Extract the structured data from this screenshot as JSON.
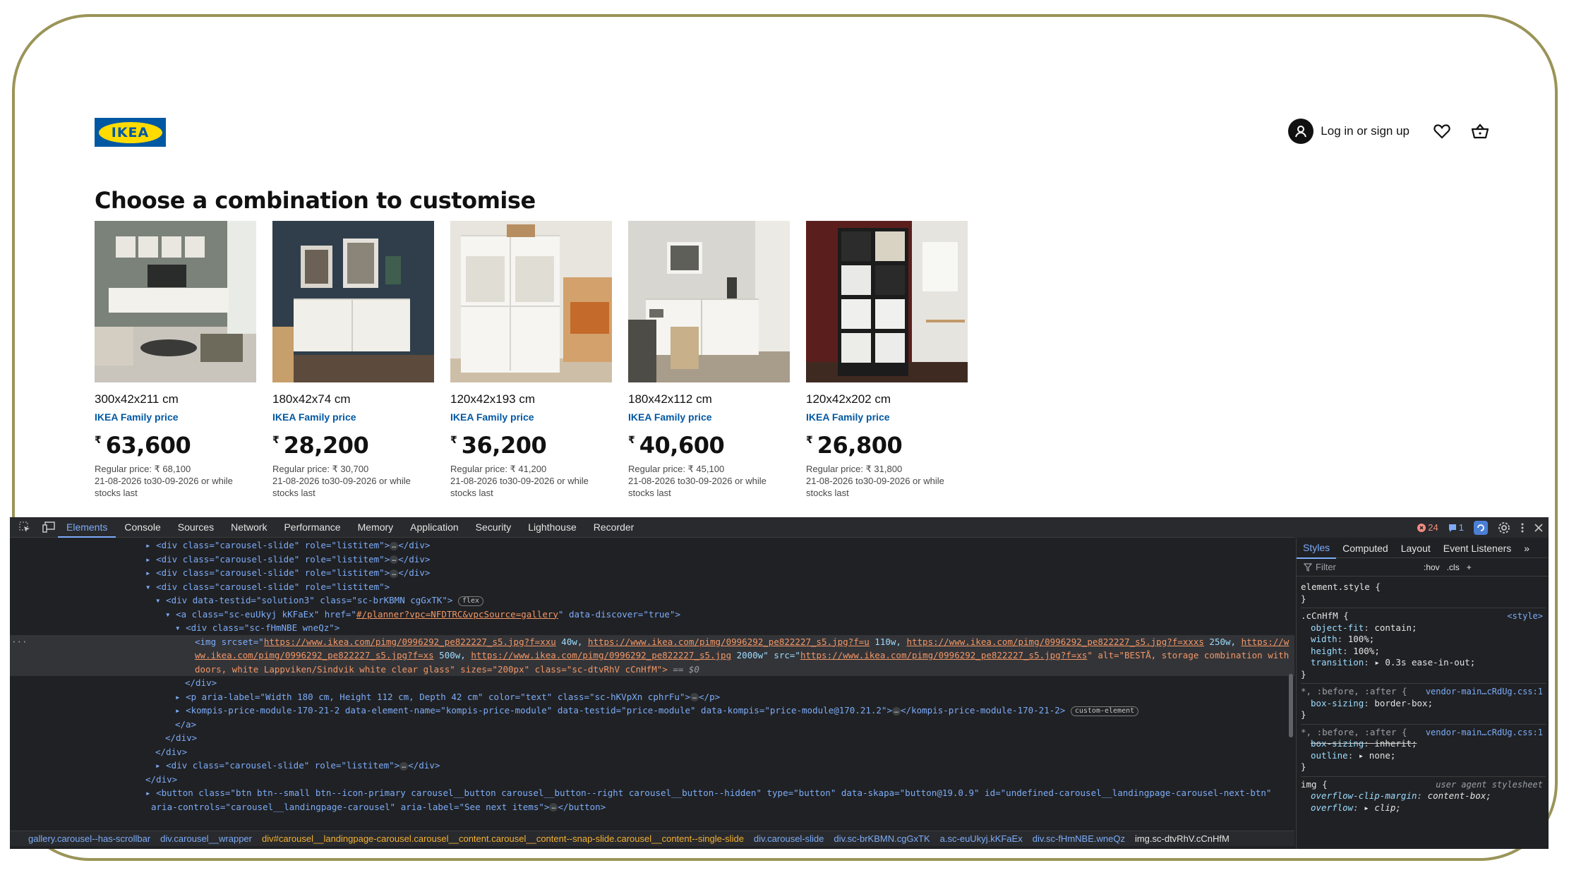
{
  "header": {
    "logo_text": "IKEA",
    "login_label": "Log in or sign up",
    "icons": [
      "user-icon",
      "heart-icon",
      "basket-icon"
    ]
  },
  "page": {
    "title": "Choose a combination to customise"
  },
  "products": [
    {
      "dims": "300x42x211 cm",
      "family": "IKEA Family price",
      "currency": "₹",
      "price": "63,600",
      "regular": "Regular price: ₹ 68,100",
      "validity": "21-08-2026 to30-09-2026 or while stocks last"
    },
    {
      "dims": "180x42x74 cm",
      "family": "IKEA Family price",
      "currency": "₹",
      "price": "28,200",
      "regular": "Regular price: ₹ 30,700",
      "validity": "21-08-2026 to30-09-2026 or while stocks last"
    },
    {
      "dims": "120x42x193 cm",
      "family": "IKEA Family price",
      "currency": "₹",
      "price": "36,200",
      "regular": "Regular price: ₹ 41,200",
      "validity": "21-08-2026 to30-09-2026 or while stocks last"
    },
    {
      "dims": "180x42x112 cm",
      "family": "IKEA Family price",
      "currency": "₹",
      "price": "40,600",
      "regular": "Regular price: ₹ 45,100",
      "validity": "21-08-2026 to30-09-2026 or while stocks last"
    },
    {
      "dims": "120x42x202 cm",
      "family": "IKEA Family price",
      "currency": "₹",
      "price": "26,800",
      "regular": "Regular price: ₹ 31,800",
      "validity": "21-08-2026 to30-09-2026 or while stocks last"
    }
  ],
  "devtools": {
    "tabs": [
      "Elements",
      "Console",
      "Sources",
      "Network",
      "Performance",
      "Memory",
      "Application",
      "Security",
      "Lighthouse",
      "Recorder"
    ],
    "active_tab": "Elements",
    "error_count": "24",
    "message_count": "1",
    "dom": {
      "slide_open": "<div class=\"carousel-slide\" role=\"listitem\">",
      "div_close": "</div>",
      "solution_div": "<div data-testid=\"solution3\" class=\"sc-brKBMN cgGxTK\">",
      "flex_badge": "flex",
      "anchor_open": "<a class=\"sc-euUkyj kKFaEx\" href=\"",
      "anchor_href": "#/planner?vpc=NFDTRC&vpcSource=gallery",
      "anchor_rest": "\" data-discover=\"true\">",
      "img_div": "<div class=\"sc-fHmNBE wneQz\">",
      "img_line1_a": "<img srcset=\"",
      "img_url1": "https://www.ikea.com/pimg/0996292_pe822227_s5.jpg?f=xxu",
      "img_w1": " 40w, ",
      "img_url2": "https://www.ikea.com/pimg/0996292_pe822227_s5.jpg?f=u",
      "img_w2": " 110w, ",
      "img_url3": "https://www.ikea.com/pimg/0996292_pe822227_s5.jpg?f=xxxs",
      "img_w3": " 250w, ",
      "img_url4a": "https://w",
      "img_url4b": "ww.ikea.com/pimg/0996292_pe822227_s5.jpg?f=xs",
      "img_w4": " 500w, ",
      "img_url5": "https://www.ikea.com/pimg/0996292_pe822227_s5.jpg",
      "img_w5": " 2000w\" src=\"",
      "img_src": "https://www.ikea.com/pimg/0996292_pe822227_s5.jpg?f=xs",
      "img_alt": "\" alt=\"BESTÅ, storage combination with",
      "img_line3": "doors, white Lappviken/Sindvik white clear glass\" sizes=\"200px\" class=\"sc-dtvRhV cCnHfM\">",
      "img_sel": " == $0",
      "p_line": "<p aria-label=\"Width 180 cm, Height 112 cm, Depth 42 cm\" color=\"text\" class=\"sc-hKVpXn cphrFu\">",
      "p_close": "</p>",
      "kompis_line": "<kompis-price-module-170-21-2 data-element-name=\"kompis-price-module\" data-testid=\"price-module\" data-kompis=\"price-module@170.21.2\">",
      "kompis_close": "</kompis-price-module-170-21-2>",
      "custom_badge": "custom-element",
      "a_close": "</a>",
      "button_line": "<button class=\"btn btn--small btn--icon-primary carousel__button carousel__button--right carousel__button--hidden\" type=\"button\" data-skapa=\"button@19.0.9\" id=\"undefined-carousel__landingpage-carousel-next-btn\"",
      "button_line2": "aria-controls=\"carousel__landingpage-carousel\" aria-label=\"See next items\">",
      "button_close": "</button>",
      "ellipsis": "…"
    },
    "breadcrumbs": [
      "gallery.carousel--has-scrollbar",
      "div.carousel__wrapper",
      "div#carousel__landingpage-carousel.carousel__content.carousel__content--snap-slide.carousel__content--single-slide",
      "div.carousel-slide",
      "div.sc-brKBMN.cgGxTK",
      "a.sc-euUkyj.kKFaEx",
      "div.sc-fHmNBE.wneQz",
      "img.sc-dtvRhV.cCnHfM"
    ],
    "styles": {
      "tabs": [
        "Styles",
        "Computed",
        "Layout",
        "Event Listeners"
      ],
      "more": "»",
      "filter_placeholder": "Filter",
      "filter_opts": [
        ":hov",
        ".cls"
      ],
      "element_style": "element.style {",
      "rule1_selector": ".cCnHfM {",
      "rule1_source": "<style>",
      "rule1_decls": [
        [
          "object-fit",
          "contain;"
        ],
        [
          "width",
          "100%;"
        ],
        [
          "height",
          "100%;"
        ],
        [
          "transition",
          "▸ 0.3s ease-in-out;"
        ]
      ],
      "rule2_selector": "*, :before, :after {",
      "rule2_source": "vendor-main…cRdUg.css:1",
      "rule2_decls": [
        [
          "box-sizing",
          "border-box;"
        ]
      ],
      "rule3_selector": "*, :before, :after {",
      "rule3_source": "vendor-main…cRdUg.css:1",
      "rule3_decls": [
        [
          "box-sizing",
          "inherit;"
        ],
        [
          "outline",
          "▸ none;"
        ]
      ],
      "rule4_selector": "img {",
      "rule4_source": "user agent stylesheet",
      "rule4_decls": [
        [
          "overflow-clip-margin",
          "content-box;"
        ],
        [
          "overflow",
          "▸ clip;"
        ]
      ],
      "close_brace": "}"
    }
  }
}
